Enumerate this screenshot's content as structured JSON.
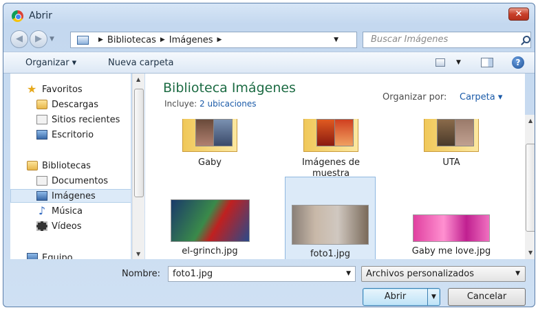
{
  "window": {
    "title": "Abrir",
    "close": "✕"
  },
  "nav": {
    "breadcrumb": [
      "Bibliotecas",
      "Imágenes"
    ],
    "search_placeholder": "Buscar Imágenes"
  },
  "toolbar": {
    "organize": "Organizar ▾",
    "new_folder": "Nueva carpeta",
    "help": "?"
  },
  "sidebar": {
    "favorites": "Favoritos",
    "fav_items": [
      "Descargas",
      "Sitios recientes",
      "Escritorio"
    ],
    "libraries": "Bibliotecas",
    "lib_items": [
      "Documentos",
      "Imágenes",
      "Música",
      "Vídeos"
    ],
    "selected": "Imágenes",
    "computer": "Equipo"
  },
  "library": {
    "title": "Biblioteca Imágenes",
    "includes_label": "Incluye:",
    "includes_link": "2 ubicaciones",
    "arrange_label": "Organizar por:",
    "arrange_value": "Carpeta ▾"
  },
  "items": [
    {
      "label": "Gaby",
      "kind": "folder"
    },
    {
      "label": "Imágenes de muestra",
      "kind": "folder"
    },
    {
      "label": "UTA",
      "kind": "folder"
    },
    {
      "label": "el-grinch.jpg",
      "kind": "image"
    },
    {
      "label": "foto1.jpg",
      "kind": "image",
      "selected": true
    },
    {
      "label": "Gaby me love.jpg",
      "kind": "image"
    }
  ],
  "bottom": {
    "name_label": "Nombre:",
    "name_value": "foto1.jpg",
    "filter": "Archivos personalizados",
    "open": "Abrir",
    "cancel": "Cancelar"
  }
}
